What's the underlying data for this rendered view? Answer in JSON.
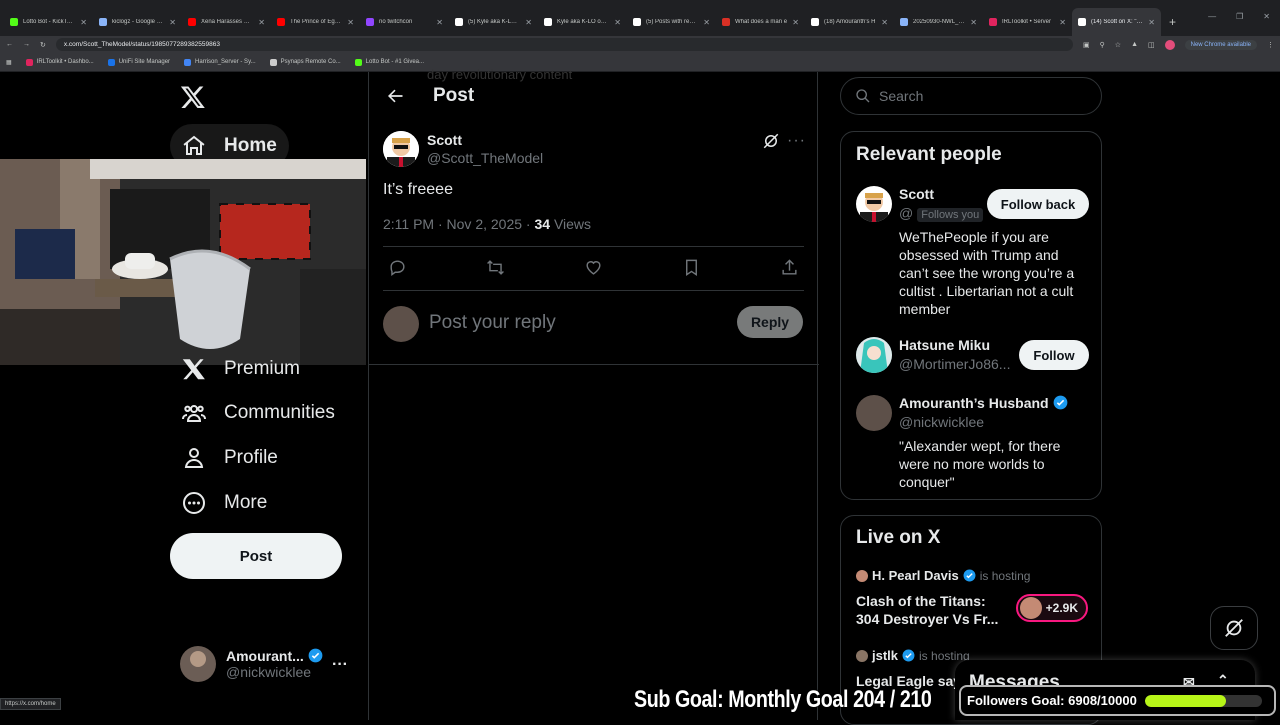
{
  "browser": {
    "tabs": [
      {
        "title": "Lotto Bot - KickTools",
        "color": "#53fc18"
      },
      {
        "title": "kiclogz - Google Sea",
        "color": "#8ab4f8"
      },
      {
        "title": "Xena Harasses Nick",
        "color": "#ff0000"
      },
      {
        "title": "The Prince of Egypt",
        "color": "#ff0000"
      },
      {
        "title": "no twitchcon",
        "color": "#9146ff"
      },
      {
        "title": "(5) Kyle aka K-LO on",
        "color": "#ffffff"
      },
      {
        "title": "Kyle aka K-LO on X:",
        "color": "#ffffff"
      },
      {
        "title": "(5) Posts with replie",
        "color": "#ffffff"
      },
      {
        "title": "What does a man e",
        "color": "#d93025"
      },
      {
        "title": "(18) Amouranth's H",
        "color": "#ffffff"
      },
      {
        "title": "20250930-NWL_STE",
        "color": "#8ab4f8"
      },
      {
        "title": "IRLToolkit • Server",
        "color": "#e0245e"
      },
      {
        "title": "(14) Scott on X: \"It's",
        "color": "#ffffff"
      }
    ],
    "new_tab": "+",
    "url": "x.com/Scott_TheModel/status/1985077289382559863",
    "new_chrome": "New Chrome available",
    "bookmarks": [
      {
        "label": "IRLToolkit • Dashbo...",
        "color": "#e0245e"
      },
      {
        "label": "UniFi Site Manager",
        "color": "#1a73e8"
      },
      {
        "label": "Harrison_Server - Sy...",
        "color": "#4285f4"
      },
      {
        "label": "Psynaps Remote Co...",
        "color": "#cccccc"
      },
      {
        "label": "Lotto Bot - #1 Givea...",
        "color": "#53fc18"
      }
    ],
    "status_url": "https://x.com/home"
  },
  "left_nav": {
    "home": "Home",
    "premium": "Premium",
    "communities": "Communities",
    "profile": "Profile",
    "more": "More",
    "post_button": "Post",
    "account": {
      "name": "Amourant...",
      "handle": "@nickwicklee"
    }
  },
  "main": {
    "header_title": "Post",
    "ghost_text": "day revolutionary content",
    "tweet": {
      "name": "Scott",
      "handle": "@Scott_TheModel",
      "text": "It’s freeee",
      "timestamp": "2:11 PM · Nov 2, 2025 · ",
      "views_count": "34",
      "views_label": " Views"
    },
    "reply_placeholder": "Post your reply",
    "reply_button": "Reply"
  },
  "sidebar": {
    "search_placeholder": "Search",
    "relevant_title": "Relevant people",
    "people": [
      {
        "name": "Scott",
        "handle": "@",
        "follows_you": "Follows you",
        "button": "Follow back",
        "bio": "WeThePeople if you are obsessed with Trump and can’t see the wrong you’re a cultist . Libertarian not a cult member"
      },
      {
        "name": "Hatsune Miku",
        "handle": "@MortimerJo86...",
        "button": "Follow"
      },
      {
        "name": "Amouranth’s Husband",
        "handle": "@nickwicklee",
        "bio": "\"Alexander wept, for there were no more worlds to conquer\""
      }
    ],
    "live_title": "Live on X",
    "live": [
      {
        "host": "H. Pearl Davis",
        "status": "is hosting",
        "title": "Clash of the Titans: 304 Destroyer Vs Fr...",
        "count": "+2.9K"
      },
      {
        "host": "jstlk",
        "status": "is hosting",
        "title": "Legal Eagle says:"
      }
    ]
  },
  "messages_title": "Messages",
  "overlay": {
    "sub_goal": "Sub Goal: Monthly Goal  204 / 210",
    "followers_goal": "Followers Goal: 6908/10000",
    "followers_progress": 0.6908
  }
}
